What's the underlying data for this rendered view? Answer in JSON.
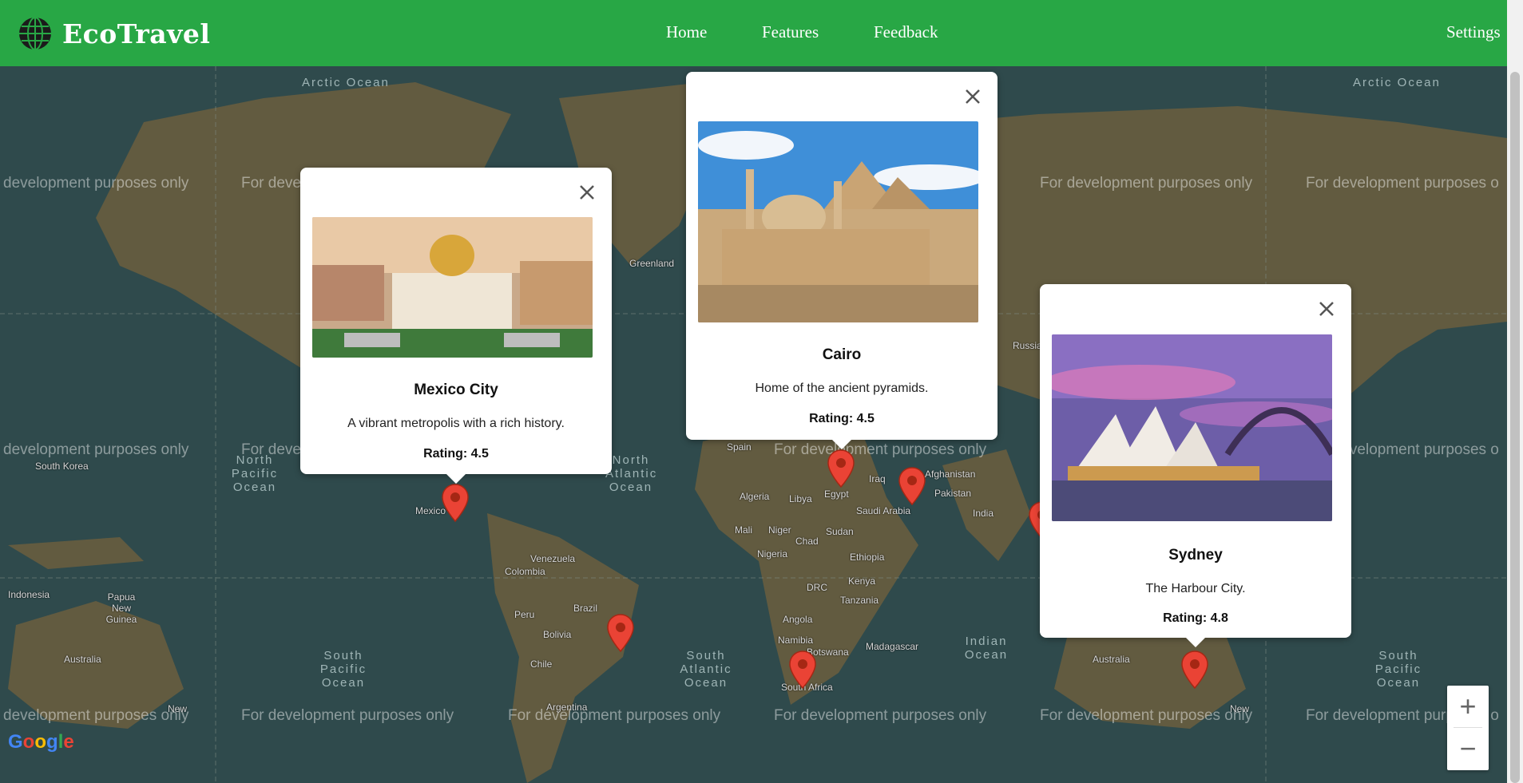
{
  "header": {
    "brand": "EcoTravel",
    "nav": {
      "home": "Home",
      "features": "Features",
      "feedback": "Feedback",
      "settings": "Settings"
    },
    "color": "#28a745"
  },
  "map": {
    "watermark": "For development purposes only",
    "watermark_left": "development purposes only",
    "watermark_right": "For development purposes o",
    "attribution": "Google",
    "zoom_in": "+",
    "zoom_out": "−",
    "oceans": {
      "arctic": "Arctic Ocean",
      "north_pacific": "North Pacific Ocean",
      "north_atlantic": "North Atlantic Ocean",
      "south_pacific": "South Pacific Ocean",
      "south_atlantic": "South Atlantic Ocean",
      "indian": "Indian Ocean"
    },
    "countries": {
      "greenland": "Greenland",
      "russia": "Russia",
      "south_korea": "South Korea",
      "indonesia": "Indonesia",
      "papua": "Papua New Guinea",
      "australia": "Australia",
      "venezuela": "Venezuela",
      "colombia": "Colombia",
      "peru": "Peru",
      "brazil": "Brazil",
      "bolivia": "Bolivia",
      "chile": "Chile",
      "argentina": "Argentina",
      "spain": "Spain",
      "algeria": "Algeria",
      "libya": "Libya",
      "egypt": "Egypt",
      "iraq": "Iraq",
      "afghanistan": "Afghanistan",
      "pakistan": "Pakistan",
      "saudi": "Saudi Arabia",
      "india": "India",
      "mali": "Mali",
      "niger": "Niger",
      "chad": "Chad",
      "sudan": "Sudan",
      "nigeria": "Nigeria",
      "ethiopia": "Ethiopia",
      "drc": "DRC",
      "kenya": "Kenya",
      "tanzania": "Tanzania",
      "angola": "Angola",
      "namibia": "Namibia",
      "botswana": "Botswana",
      "madagascar": "Madagascar",
      "south_africa": "South Africa",
      "mexico": "Mexico",
      "new": "New"
    }
  },
  "popups": [
    {
      "city": "Mexico City",
      "description": "A vibrant metropolis with a rich history.",
      "rating": "Rating: 4.5"
    },
    {
      "city": "Cairo",
      "description": "Home of the ancient pyramids.",
      "rating": "Rating: 4.5"
    },
    {
      "city": "Sydney",
      "description": "The Harbour City.",
      "rating": "Rating: 4.8"
    }
  ],
  "colors": {
    "pin": "#ea4335",
    "pin_dark": "#a52714",
    "land": "#6b5e3e",
    "water": "#2f4a4c"
  }
}
